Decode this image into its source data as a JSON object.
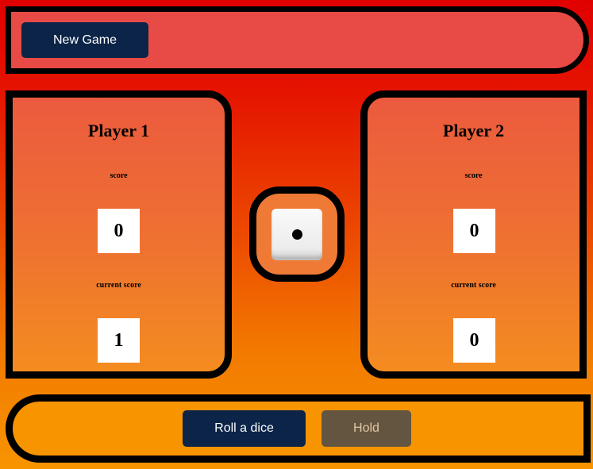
{
  "toolbar": {
    "new_game_label": "New Game"
  },
  "players": [
    {
      "name": "Player 1",
      "score_label": "score",
      "score": "0",
      "current_label": "current score",
      "current": "1"
    },
    {
      "name": "Player 2",
      "score_label": "score",
      "score": "0",
      "current_label": "current score",
      "current": "0"
    }
  ],
  "dice": {
    "value": 1,
    "icon": "dice-one-icon"
  },
  "controls": {
    "roll_label": "Roll a dice",
    "hold_label": "Hold"
  },
  "colors": {
    "button_primary": "#0b2447",
    "button_hold": "#635540",
    "button_hold_text": "#e2c7a5"
  }
}
